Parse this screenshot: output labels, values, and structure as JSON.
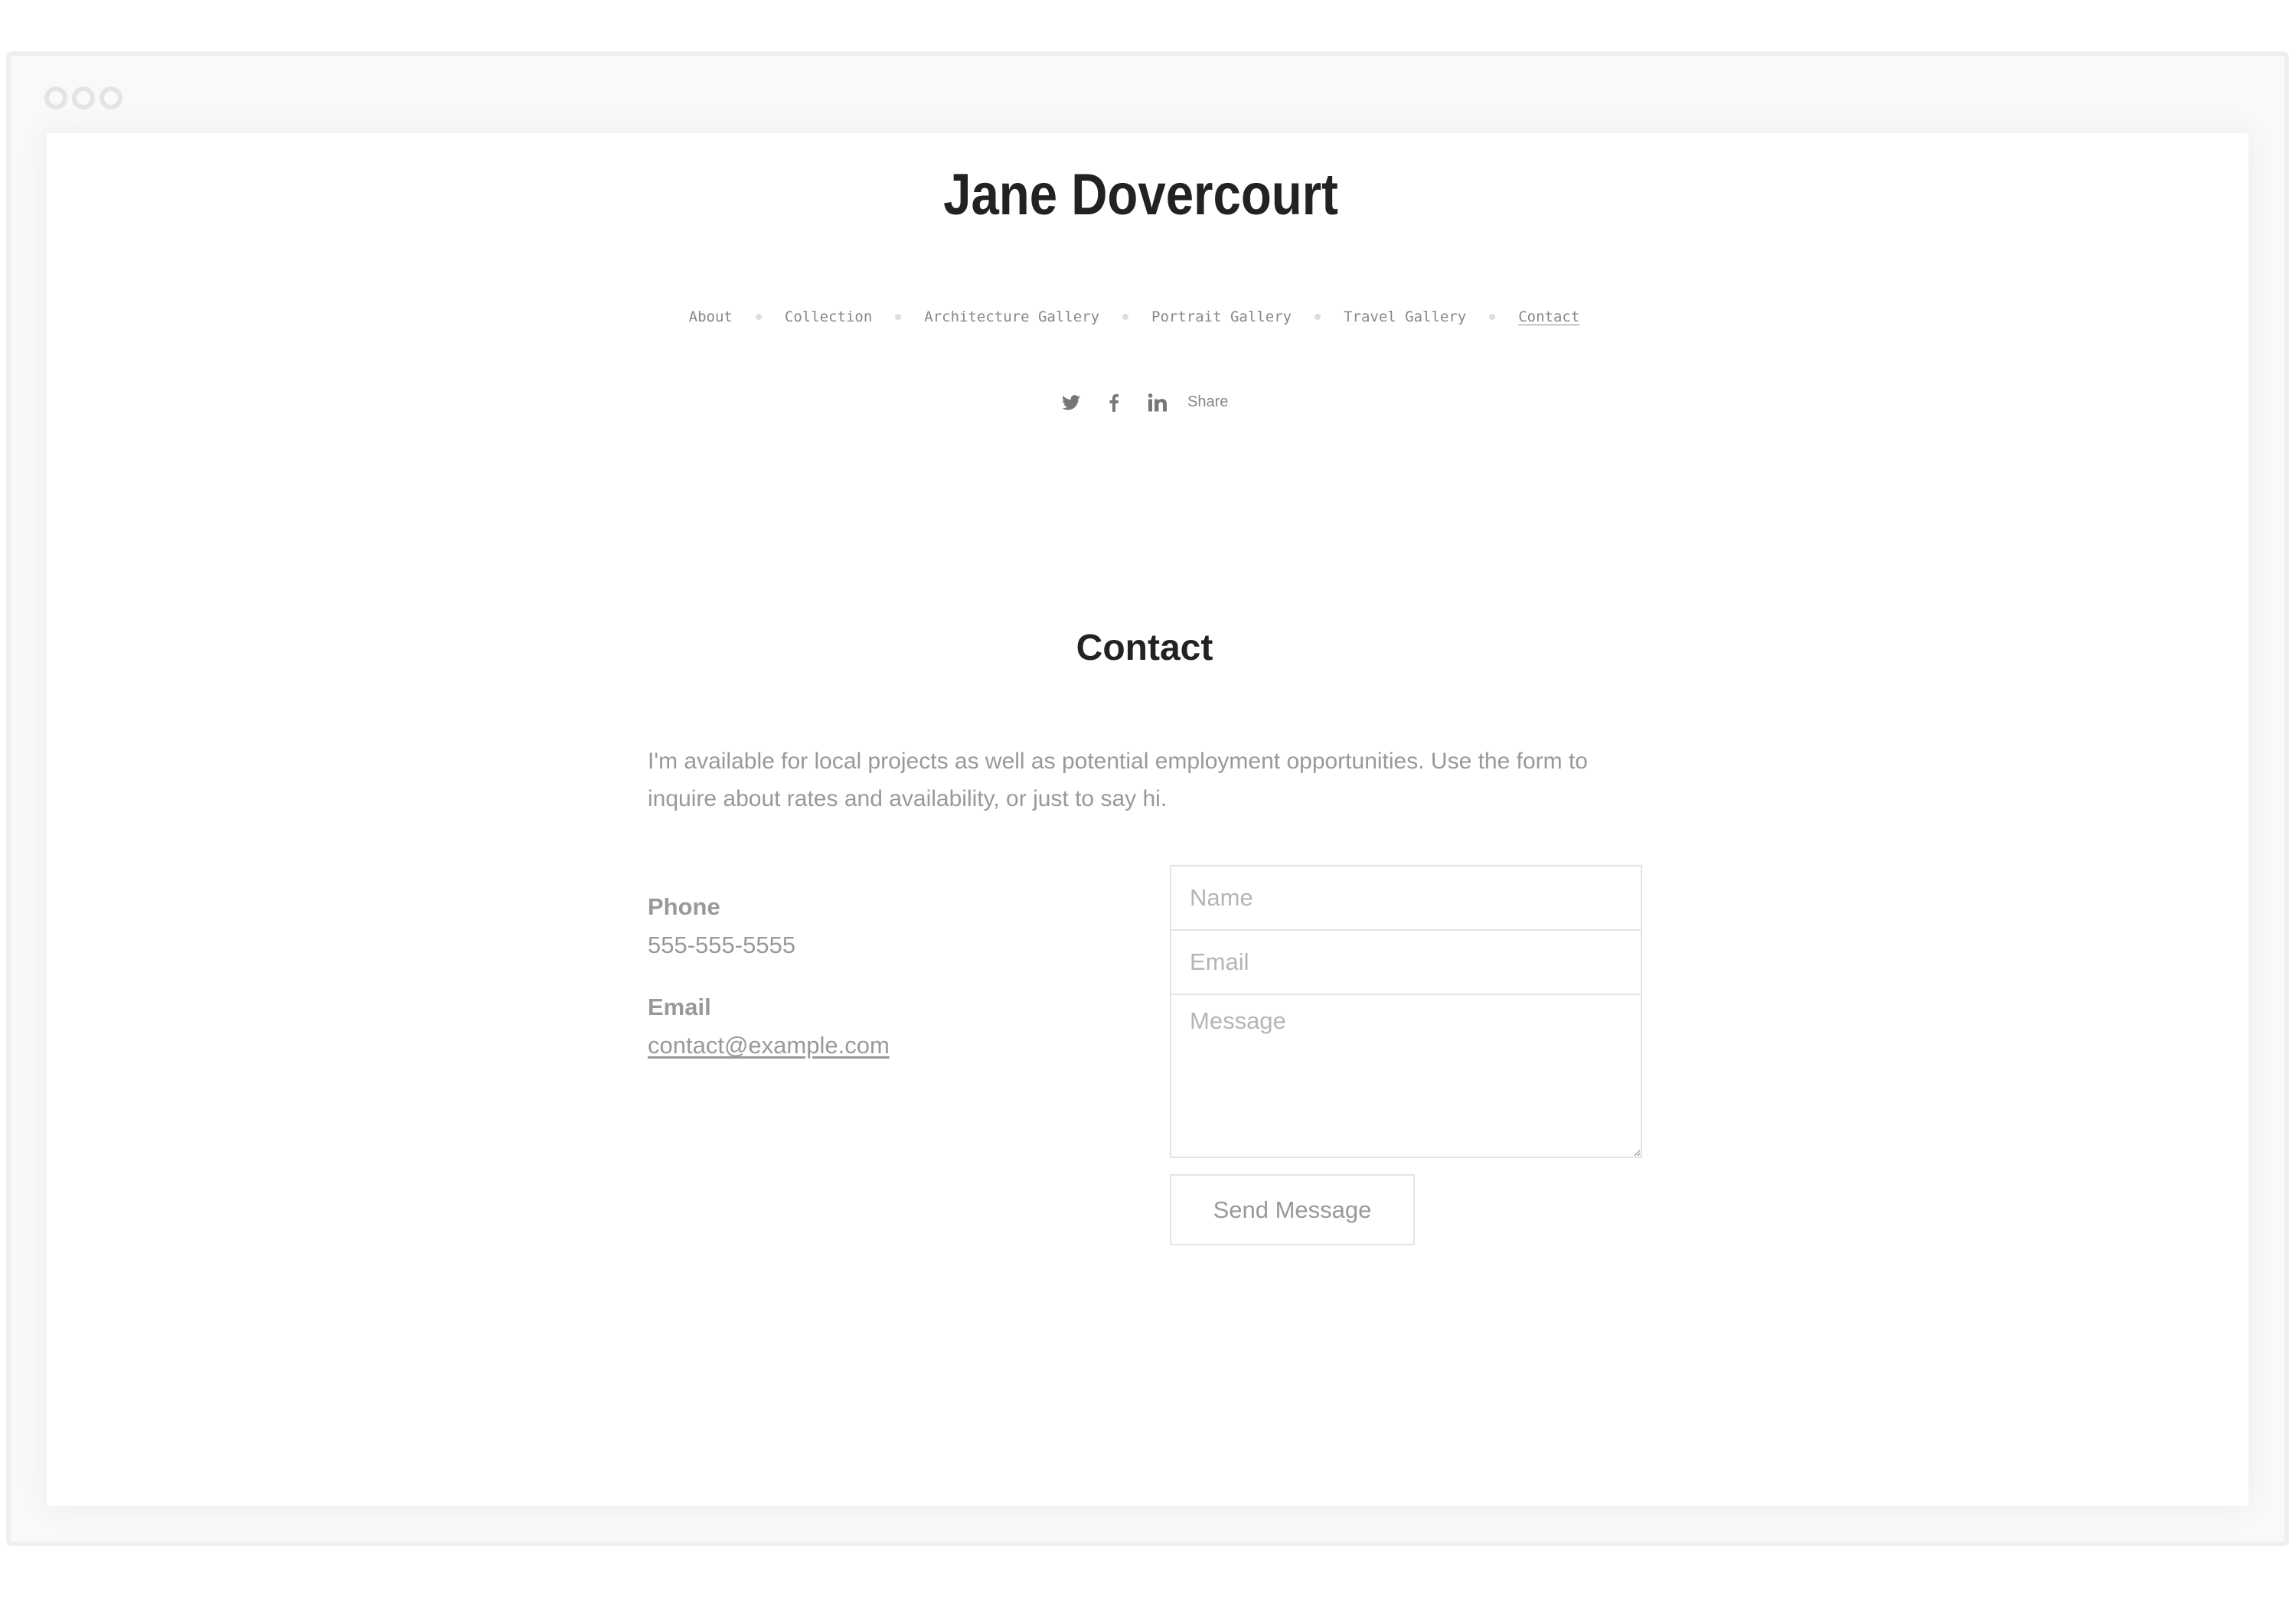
{
  "window": {
    "controls": [
      "close",
      "minimize",
      "maximize"
    ]
  },
  "site": {
    "title": "Jane Dovercourt"
  },
  "nav": {
    "items": [
      {
        "label": "About",
        "active": false
      },
      {
        "label": "Collection",
        "active": false
      },
      {
        "label": "Architecture Gallery",
        "active": false
      },
      {
        "label": "Portrait Gallery",
        "active": false
      },
      {
        "label": "Travel Gallery",
        "active": false
      },
      {
        "label": "Contact",
        "active": true
      }
    ]
  },
  "social": {
    "icons": [
      "twitter-icon",
      "facebook-icon",
      "linkedin-icon"
    ],
    "share_label": "Share"
  },
  "contact": {
    "heading": "Contact",
    "intro": "I'm available for local projects as well as potential employment opportunities. Use the form to inquire about rates and availability, or just to say hi.",
    "phone_label": "Phone",
    "phone_value": "555-555-5555",
    "email_label": "Email",
    "email_value": "contact@example.com"
  },
  "form": {
    "name_placeholder": "Name",
    "name_value": "",
    "email_placeholder": "Email",
    "email_value": "",
    "message_placeholder": "Message",
    "message_value": "",
    "submit_label": "Send Message"
  },
  "colors": {
    "heading": "#222222",
    "body_text": "#999999",
    "nav_text": "#888888",
    "border": "#e4e4e4"
  }
}
